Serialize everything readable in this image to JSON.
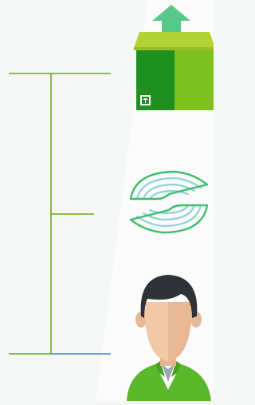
{
  "colors": {
    "background": "#f5f6f6",
    "connector": "#6aaa1e",
    "connector_end": "#4a86c5",
    "box_lid": "#b3d334",
    "box_front_dark": "#1f8f1f",
    "box_front_light": "#7dc21e",
    "arrow": "#58c98a",
    "exchange": "#3fbf6f",
    "exchange_inner": "#8fd4d8",
    "hair": "#2f3338",
    "skin": "#f2c8a6",
    "shirt": "#5bb82a"
  },
  "icons": {
    "shipment": "package-upload-icon",
    "exchange": "exchange-arrows-icon",
    "person": "user-avatar-icon"
  }
}
